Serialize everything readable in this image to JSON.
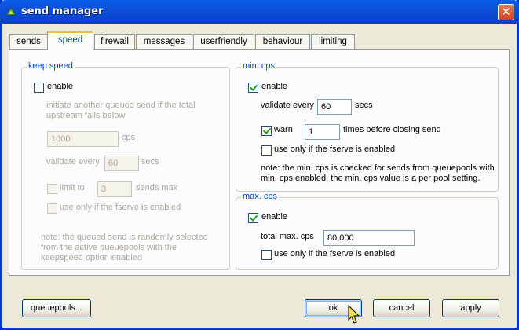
{
  "window": {
    "title": "send manager"
  },
  "tabs": [
    "sends",
    "speed",
    "firewall",
    "messages",
    "userfriendly",
    "behaviour",
    "limiting"
  ],
  "active_tab": "speed",
  "keep_speed": {
    "legend": "keep speed",
    "enable_label": "enable",
    "enabled": false,
    "desc_line1": "initiate another queued send if the total",
    "desc_line2": "upstream falls below",
    "cps_value": "1000",
    "cps_unit": "cps",
    "validate_label": "validate every",
    "validate_value": "60",
    "validate_unit": "secs",
    "limit_label": "limit to",
    "limit_value": "3",
    "limit_unit": "sends max",
    "fserve_label": "use only if the fserve is enabled",
    "note_line1": "note: the queued send is randomly selected",
    "note_line2": "from the active queuepools with the",
    "note_line3": "keepspeed option enabled"
  },
  "min_cps": {
    "legend": "min. cps",
    "enable_label": "enable",
    "enabled": true,
    "validate_label": "validate every",
    "validate_value": "60",
    "validate_unit": "secs",
    "warn_label": "warn",
    "warn_checked": true,
    "warn_value": "1",
    "warn_suffix": "times before closing send",
    "fserve_label": "use only if the fserve is enabled",
    "note_line1": "note: the min. cps is checked for sends from queuepools with",
    "note_line2": "min. cps enabled. the min. cps value is a per pool setting."
  },
  "max_cps": {
    "legend": "max. cps",
    "enable_label": "enable",
    "enabled": true,
    "total_label": "total max. cps",
    "total_value": "80,000",
    "fserve_label": "use only if the fserve is enabled"
  },
  "buttons": {
    "queuepools": "queuepools...",
    "ok": "ok",
    "cancel": "cancel",
    "apply": "apply"
  },
  "colors": {
    "titlebar": "#0a5fe8",
    "legend": "#0046d5",
    "active_tab_accent": "#f5b94a"
  }
}
